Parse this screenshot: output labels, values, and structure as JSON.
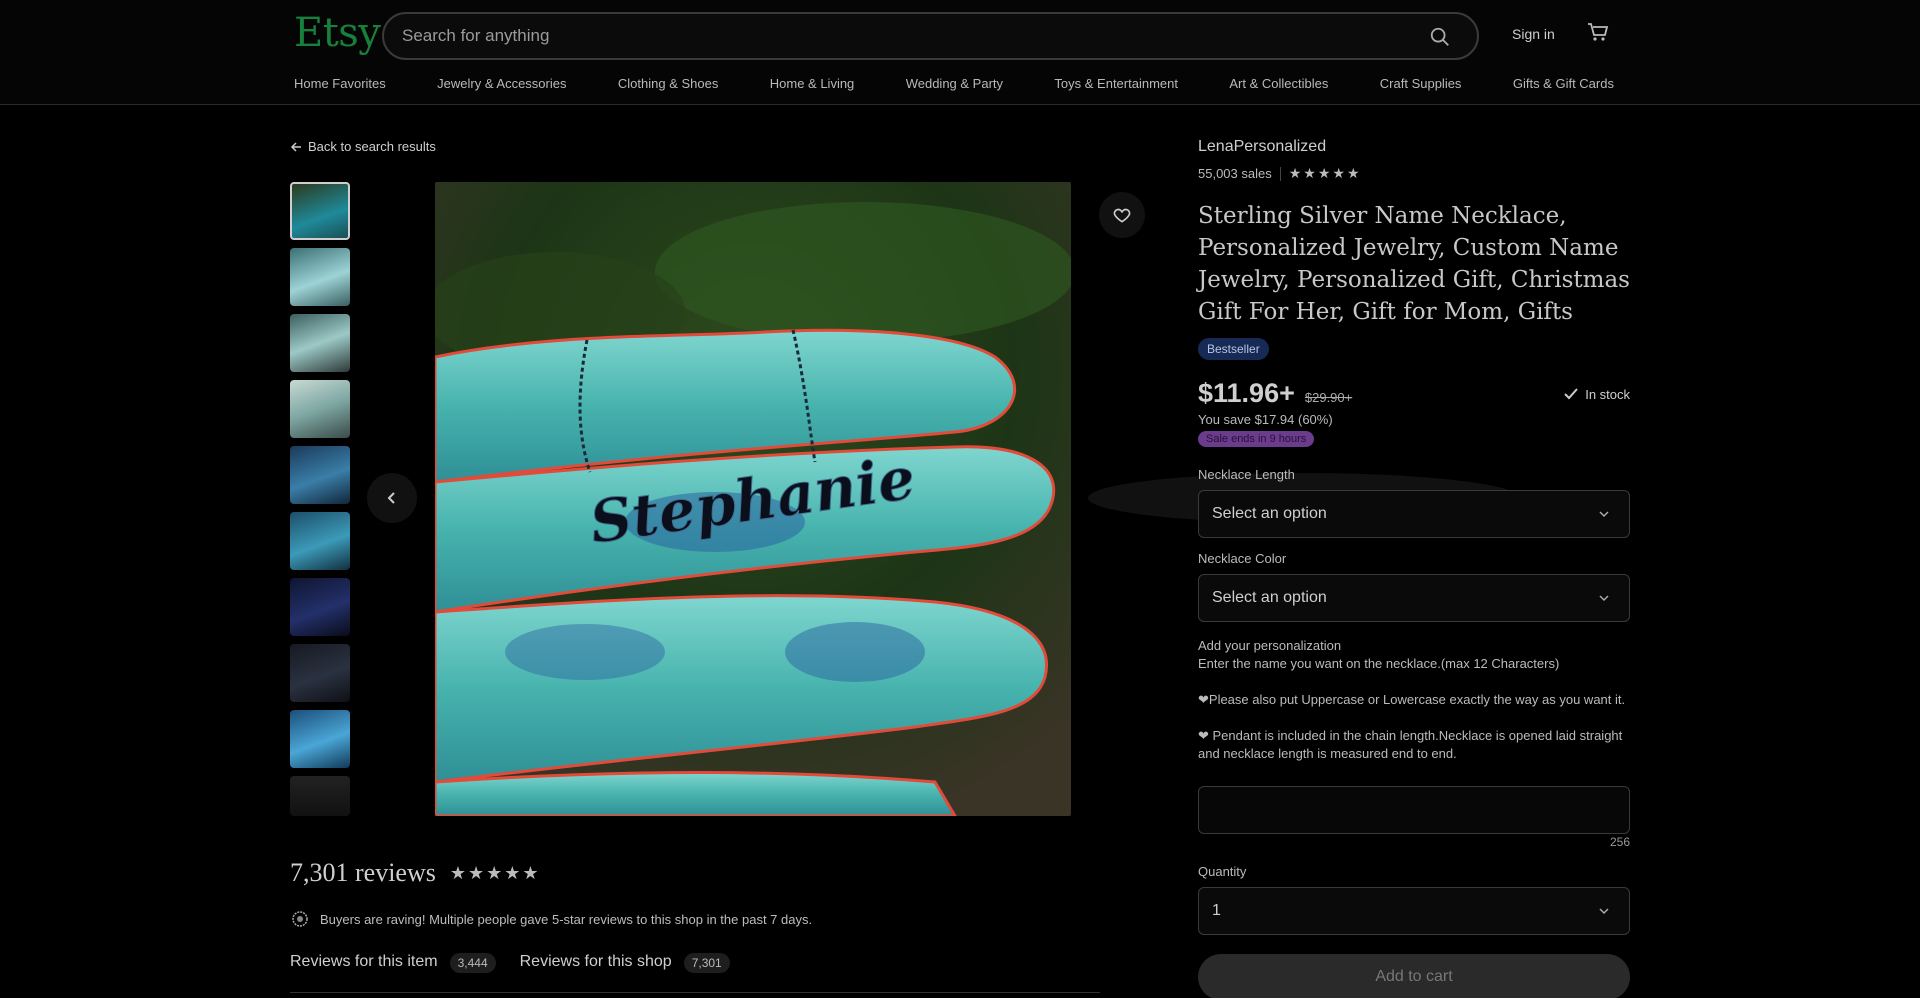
{
  "header": {
    "logo": "Etsy",
    "search_placeholder": "Search for anything",
    "signin": "Sign in",
    "nav": [
      "Home Favorites",
      "Jewelry & Accessories",
      "Clothing & Shoes",
      "Home & Living",
      "Wedding & Party",
      "Toys & Entertainment",
      "Art & Collectibles",
      "Craft Supplies",
      "Gifts & Gift Cards"
    ]
  },
  "back_link": "Back to search results",
  "gallery": {
    "main_image_text": "Stephanie",
    "thumbnail_count": 10
  },
  "listing": {
    "shop_name": "LenaPersonalized",
    "sales": "55,003 sales",
    "rating_stars": "★★★★★",
    "title": "Sterling Silver Name Necklace, Personalized Jewelry, Custom Name Jewelry, Personalized Gift, Christmas Gift For Her, Gift for Mom, Gifts",
    "badge": "Bestseller",
    "price": "$11.96+",
    "old_price": "$29.90+",
    "stock": "In stock",
    "you_save": "You save $17.94 (60%)",
    "sale_note": "Sale ends in 9 hours",
    "necklace_length_label": "Necklace Length",
    "necklace_length_value": "Select an option",
    "necklace_color_label": "Necklace Color",
    "necklace_color_value": "Select an option",
    "personalization_title": "Add your personalization",
    "personalization_line1": "Enter the name you want on the necklace.(max 12 Characters)",
    "personalization_line2": "❤Please also put Uppercase or Lowercase exactly the way as you want it.",
    "personalization_line3": "❤ Pendant is included in the chain length.Necklace is opened laid straight and necklace length is measured end to end.",
    "char_count": "256",
    "quantity_label": "Quantity",
    "quantity_value": "1",
    "add_to_cart": "Add to cart"
  },
  "reviews": {
    "title": "7,301 reviews",
    "stars": "★★★★★",
    "raving": "Buyers are raving! Multiple people gave 5-star reviews to this shop in the past 7 days.",
    "tab_item": "Reviews for this item",
    "tab_item_count": "3,444",
    "tab_shop": "Reviews for this shop",
    "tab_shop_count": "7,301"
  }
}
